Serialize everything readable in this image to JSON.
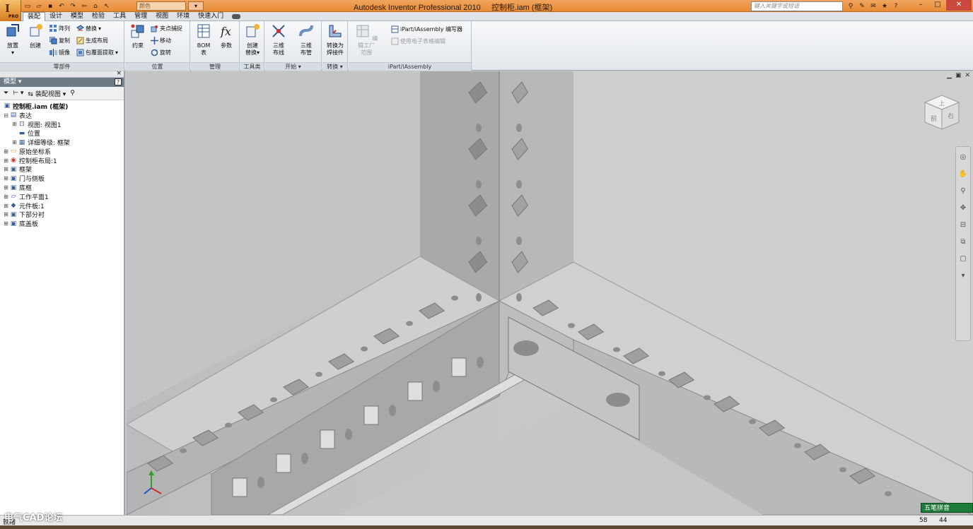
{
  "app": {
    "logo_glyph": "I",
    "logo_badge": "PRO",
    "window_title": "Autodesk Inventor Professional 2010     控制柜.iam (框架)",
    "appearance_value": "颜色",
    "search_placeholder": "键入关键字或短语",
    "accent": "#e98b35"
  },
  "qat": [
    "file-icon",
    "open-icon",
    "save-icon",
    "undo-icon",
    "redo-icon",
    "new-icon",
    "select-icon"
  ],
  "ribbon_tabs": [
    "装配",
    "设计",
    "模型",
    "检验",
    "工具",
    "管理",
    "视图",
    "环境",
    "快速入门"
  ],
  "panels": {
    "component": {
      "label": "零部件",
      "place": "放置",
      "create": "创建",
      "pattern": "阵列",
      "copy": "复制",
      "mirror": "镜像",
      "replace": "替换",
      "layout": "生成布局",
      "shrinkwrap": "包覆面提取"
    },
    "position": {
      "label": "位置",
      "constrain": "约束",
      "grip": "夹点捕捉",
      "move": "移动",
      "rotate": "旋转"
    },
    "manage": {
      "label": "管理",
      "bom_line1": "BOM",
      "bom_line2": "表",
      "params": "参数"
    },
    "productivity": {
      "label": "工具类",
      "line1": "创建",
      "line2": "替换"
    },
    "begin": {
      "label": "开始",
      "route_line1": "三维",
      "route_line2": "布线",
      "tube_line1": "三维",
      "tube_line2": "布管"
    },
    "convert": {
      "label": "转换",
      "line1": "转换为",
      "line2": "焊接件"
    },
    "ipart": {
      "label": "iPart/iAssembly",
      "factory_line1": "编辑工厂",
      "factory_line2": "范围",
      "author": "iPart/iAssembly 编写器",
      "spreadsheet": "使用电子表格编辑"
    }
  },
  "browser": {
    "title": "模型",
    "help": "?",
    "view_label": "装配视图",
    "tree": [
      {
        "label": "控制柜.iam (框架)",
        "icon": "assembly-icon",
        "expander": "",
        "level": 0
      },
      {
        "label": "表达",
        "icon": "representations-icon",
        "expander": "⊟",
        "level": 1
      },
      {
        "label": "视图: 视图1",
        "icon": "view-rep-icon",
        "expander": "⊞",
        "level": 2
      },
      {
        "label": "位置",
        "icon": "position-rep-icon",
        "expander": "",
        "level": 2
      },
      {
        "label": "详细等级: 框架",
        "icon": "lod-icon",
        "expander": "⊞",
        "level": 2
      },
      {
        "label": "原始坐标系",
        "icon": "folder-icon",
        "expander": "⊞",
        "level": 1
      },
      {
        "label": "控制柜布局:1",
        "icon": "layout-icon",
        "expander": "⊞",
        "level": 1
      },
      {
        "label": "框架",
        "icon": "subassembly-icon",
        "expander": "⊞",
        "level": 1
      },
      {
        "label": "门与侧板",
        "icon": "subassembly-icon",
        "expander": "⊞",
        "level": 1
      },
      {
        "label": "底框",
        "icon": "subassembly-icon",
        "expander": "⊞",
        "level": 1
      },
      {
        "label": "工作平面1",
        "icon": "workplane-icon",
        "expander": "⊞",
        "level": 1
      },
      {
        "label": "元件板:1",
        "icon": "part-icon",
        "expander": "⊞",
        "level": 1
      },
      {
        "label": "下部分衬",
        "icon": "subassembly-icon",
        "expander": "⊞",
        "level": 1
      },
      {
        "label": "底盖板",
        "icon": "subassembly-icon",
        "expander": "⊞",
        "level": 1
      }
    ]
  },
  "viewcube": {
    "top_face": "上",
    "right_face": "右",
    "front_face": "前"
  },
  "status": {
    "text": "就绪",
    "n1": "58",
    "n2": "44"
  },
  "ime": "五笔拼音",
  "watermark": {
    "text": "电气CAD论坛",
    "logo": "eA"
  }
}
